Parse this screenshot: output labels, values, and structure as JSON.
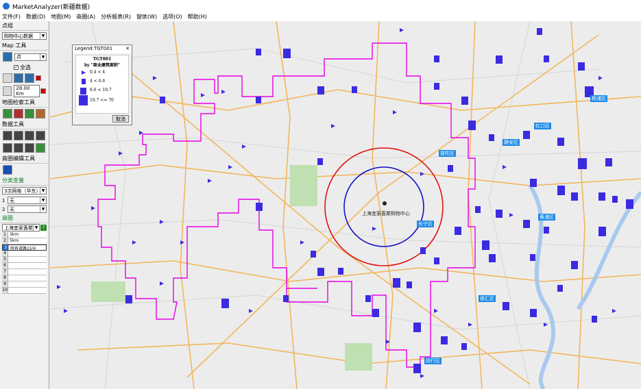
{
  "window": {
    "title": "MarketAnalyzer(新疆数据)"
  },
  "menu": [
    "文件(F)",
    "数据(D)",
    "地图(M)",
    "商圈(A)",
    "分析报表(R)",
    "窗体(W)",
    "选项(O)",
    "帮助(H)"
  ],
  "sidebar": {
    "point_group_header": "点组",
    "point_group_value": "购物中心数据",
    "map_tools_header": "Map 工具",
    "map_layer_value": "点",
    "select_all_label": "全选",
    "distance_value": "28.00 Km",
    "map_search_header": "地图检索工具",
    "data_tools_header": "数据工具",
    "trade_area_edit_header": "商圈编辑工具",
    "classify_header": "分类变量",
    "classify_value": "3次网格（华东）",
    "var1_label": "1",
    "var1_value": "无",
    "var2_label": "2",
    "var2_value": "无",
    "trade_area_header": "商圈",
    "trade_area_value": "上海宜家荟聚",
    "rings": [
      {
        "n": "1",
        "v": "3km"
      },
      {
        "n": "2",
        "v": "5km"
      },
      {
        "n": "3",
        "v": "所有道路15分"
      },
      {
        "n": "4",
        "v": ""
      },
      {
        "n": "5",
        "v": ""
      },
      {
        "n": "6",
        "v": ""
      },
      {
        "n": "7",
        "v": ""
      },
      {
        "n": "8",
        "v": ""
      },
      {
        "n": "9",
        "v": ""
      },
      {
        "n": "10",
        "v": ""
      }
    ]
  },
  "legend": {
    "window_title": "Legend:TGT001",
    "title": "TGT001",
    "subtitle": "by \"商业建筑面积\"",
    "rows": [
      "0.4 < 4",
      "4 < 6.6",
      "6.6 < 10.7",
      "10.7 <= 70"
    ],
    "cancel_label": "取消"
  },
  "map": {
    "center_label": "上海宜家荟聚购物中心",
    "districts": [
      "杨浦区",
      "虹口区",
      "静安区",
      "普陀区",
      "黄浦区",
      "长宁区",
      "徐汇区",
      "闵行区"
    ],
    "colors": {
      "ring_inner": "#1010c8",
      "ring_outer": "#e01010",
      "isochrone": "#e600e6",
      "roads": "#f5b04a",
      "point": "#3b2be0"
    }
  }
}
